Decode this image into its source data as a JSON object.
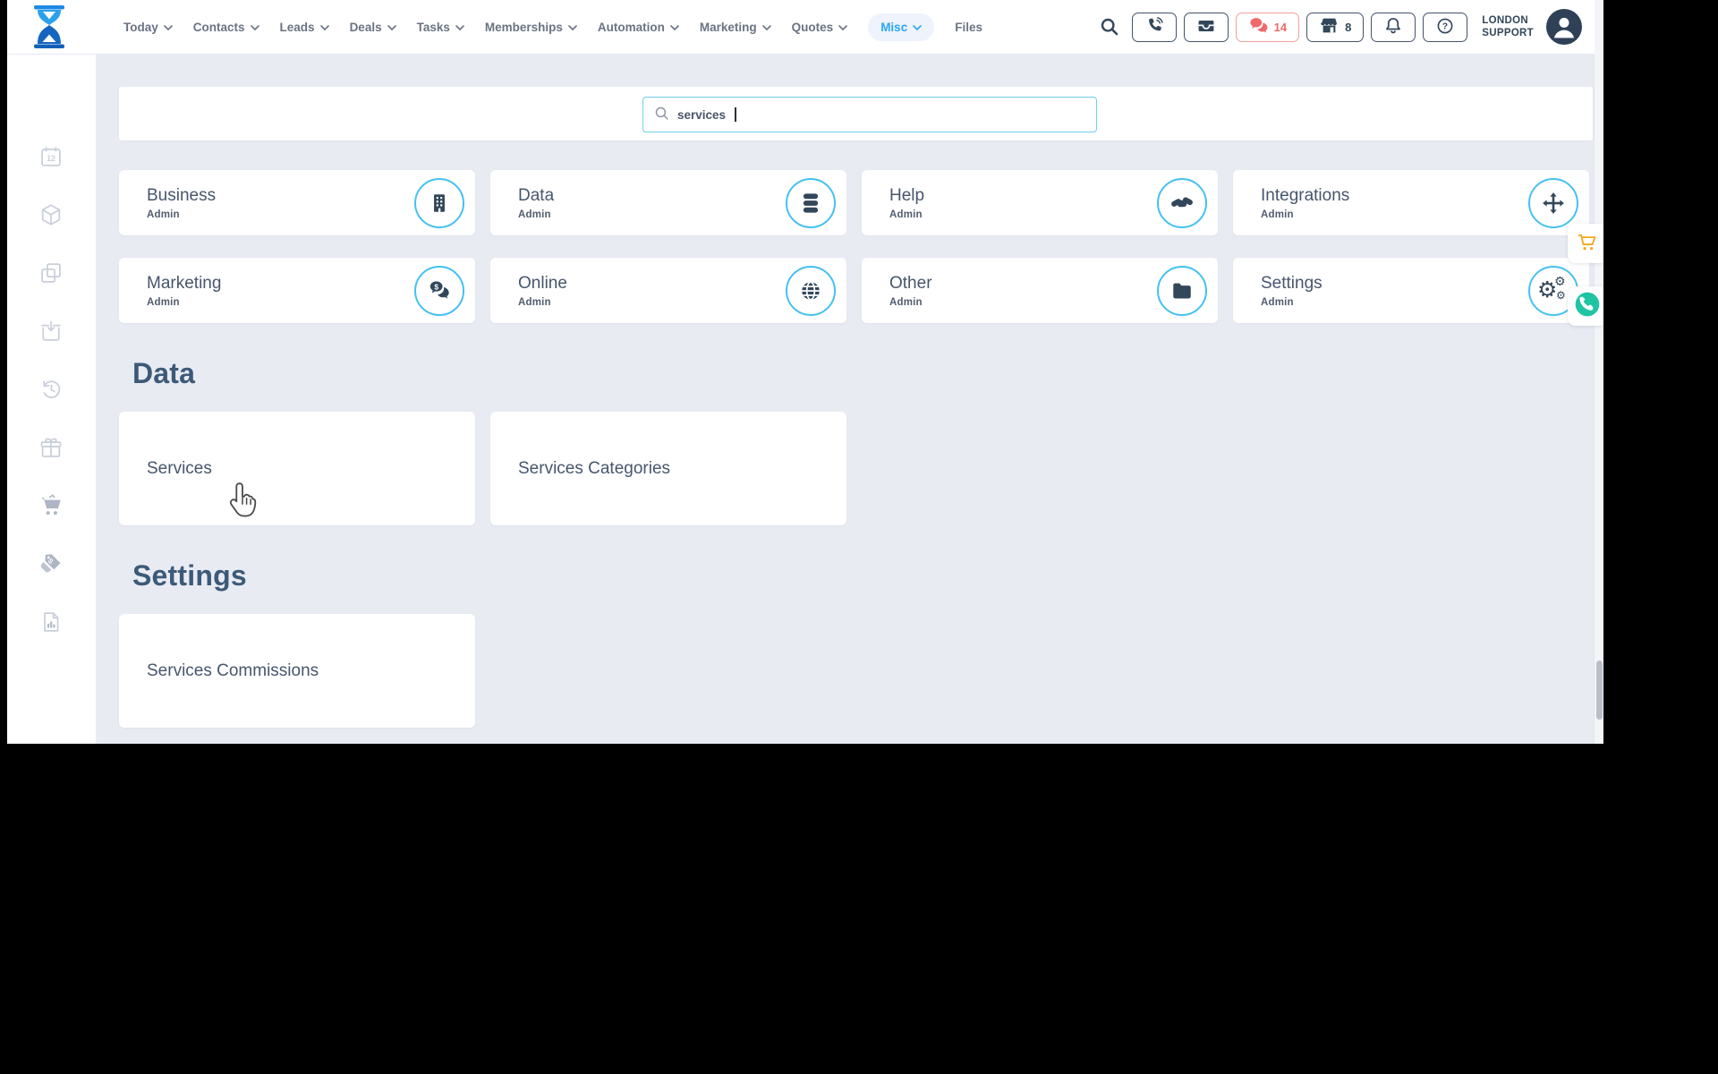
{
  "header": {
    "nav_items": [
      {
        "label": "Today"
      },
      {
        "label": "Contacts"
      },
      {
        "label": "Leads"
      },
      {
        "label": "Deals"
      },
      {
        "label": "Tasks"
      },
      {
        "label": "Memberships"
      },
      {
        "label": "Automation"
      },
      {
        "label": "Marketing"
      },
      {
        "label": "Quotes"
      },
      {
        "label": "Misc"
      },
      {
        "label": "Files"
      }
    ],
    "chat_badge": "14",
    "store_badge": "8",
    "account_line1": "LONDON",
    "account_line2": "SUPPORT"
  },
  "search": {
    "value": "services"
  },
  "sidebar": {
    "calendar_label": "12",
    "icons": [
      "calendar-12",
      "package",
      "copy",
      "inbox-in",
      "history",
      "gift",
      "cart",
      "tags",
      "report-doc"
    ]
  },
  "category_cards": [
    {
      "title": "Business",
      "subtitle": "Admin",
      "icon": "building"
    },
    {
      "title": "Data",
      "subtitle": "Admin",
      "icon": "database"
    },
    {
      "title": "Help",
      "subtitle": "Admin",
      "icon": "handshake"
    },
    {
      "title": "Integrations",
      "subtitle": "Admin",
      "icon": "arrows-move"
    },
    {
      "title": "Marketing",
      "subtitle": "Admin",
      "icon": "money-chat"
    },
    {
      "title": "Online",
      "subtitle": "Admin",
      "icon": "globe"
    },
    {
      "title": "Other",
      "subtitle": "Admin",
      "icon": "folder"
    },
    {
      "title": "Settings",
      "subtitle": "Admin",
      "icon": "gears"
    }
  ],
  "sections": [
    {
      "heading": "Data",
      "cards": [
        {
          "label": "Services"
        },
        {
          "label": "Services Categories"
        }
      ]
    },
    {
      "heading": "Settings",
      "cards": [
        {
          "label": "Services Commissions"
        }
      ]
    }
  ],
  "colors": {
    "accent_blue": "#2aa7f2",
    "icon_ring": "#45c1f0",
    "navy": "#33475b",
    "salmon": "#ee6a6a",
    "orange": "#f5a623",
    "teal": "#1fc5a3",
    "main_bg": "#e9ebf3",
    "heading": "#3c5a78",
    "card_title": "#46566c"
  }
}
